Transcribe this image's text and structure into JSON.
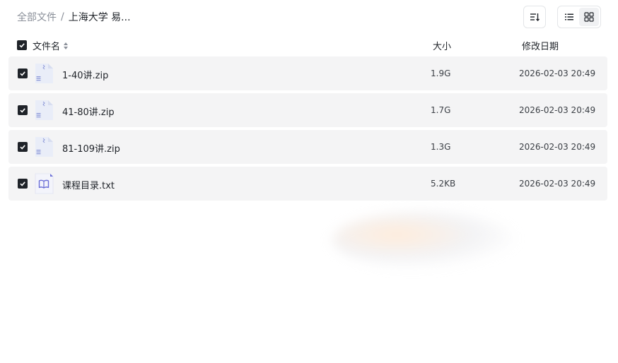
{
  "breadcrumb": {
    "root": "全部文件",
    "separator": "/",
    "current": "上海大学 易..."
  },
  "toolbar": {
    "sort_icon": "sort-icon",
    "list_view_icon": "list-view-icon",
    "grid_view_icon": "grid-view-icon",
    "active_view": "grid"
  },
  "table": {
    "columns": {
      "name": "文件名",
      "size": "大小",
      "date": "修改日期"
    },
    "select_all_checked": true,
    "files": [
      {
        "name": "1-40讲.zip",
        "size": "1.9G",
        "date": "2026-02-03 20:49",
        "type": "zip",
        "icon": "zip-file-icon",
        "checked": true
      },
      {
        "name": "41-80讲.zip",
        "size": "1.7G",
        "date": "2026-02-03 20:49",
        "type": "zip",
        "icon": "zip-file-icon",
        "checked": true
      },
      {
        "name": "81-109讲.zip",
        "size": "1.3G",
        "date": "2026-02-03 20:49",
        "type": "zip",
        "icon": "zip-file-icon",
        "checked": true
      },
      {
        "name": "课程目录.txt",
        "size": "5.2KB",
        "date": "2026-02-03 20:49",
        "type": "txt",
        "icon": "text-file-icon",
        "checked": true
      }
    ]
  },
  "colors": {
    "row_background": "#f4f4f5",
    "checkbox": "#1f2329",
    "icon_accent": "#6b6fd6"
  }
}
